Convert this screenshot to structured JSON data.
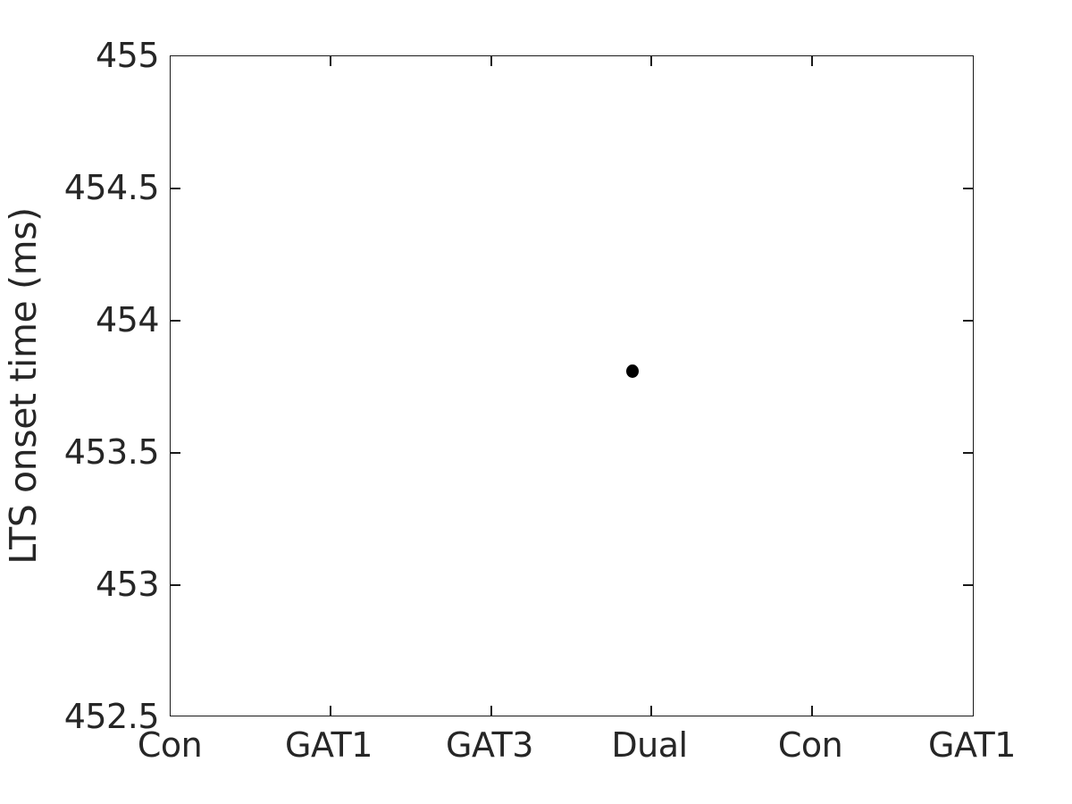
{
  "chart_data": {
    "type": "scatter",
    "title": "",
    "xlabel": "",
    "ylabel": "LTS onset time (ms)",
    "categories": [
      "Con",
      "GAT1",
      "GAT3",
      "Dual",
      "Con",
      "GAT1"
    ],
    "xtick_positions": [
      1,
      2,
      3,
      4,
      5,
      6
    ],
    "ylim": [
      452.5,
      455
    ],
    "yticks": [
      452.5,
      453,
      453.5,
      454,
      454.5,
      455
    ],
    "ytick_labels": [
      "452.5",
      "453",
      "453.5",
      "454",
      "454.5",
      "455"
    ],
    "grid": false,
    "legend": null,
    "marker": {
      "shape": "circle",
      "color": "#000000",
      "size": 14
    },
    "points": [
      {
        "category": "Dual",
        "x": 3.87,
        "y": 453.81
      }
    ],
    "series": [
      {
        "name": "LTS onset time",
        "x": [
          3.87
        ],
        "values": [
          453.81
        ],
        "color": "#000000"
      }
    ],
    "axes": {
      "box": true,
      "tick_direction": "in",
      "line_color": "#1a1a1a",
      "text_color": "#262626",
      "background": "#ffffff"
    }
  }
}
